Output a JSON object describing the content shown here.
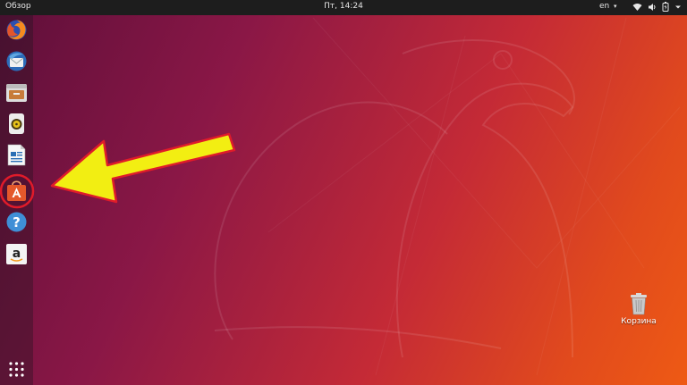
{
  "topbar": {
    "activities_label": "Обзор",
    "clock": "Пт, 14:24",
    "language": "en",
    "language_arrow": "▾",
    "wifi_icon": "wifi-icon",
    "volume_icon": "volume-icon",
    "battery_icon": "battery-icon",
    "menu_icon": "system-menu-arrow-icon"
  },
  "dock": {
    "items": [
      {
        "name": "firefox",
        "icon": "firefox-icon"
      },
      {
        "name": "thunderbird",
        "icon": "thunderbird-icon"
      },
      {
        "name": "files",
        "icon": "files-icon"
      },
      {
        "name": "rhythmbox",
        "icon": "rhythmbox-icon"
      },
      {
        "name": "libreoffice-writer",
        "icon": "writer-icon"
      },
      {
        "name": "ubuntu-software",
        "icon": "software-center-icon",
        "highlighted": true
      },
      {
        "name": "help",
        "icon": "help-icon"
      },
      {
        "name": "amazon",
        "icon": "amazon-icon"
      }
    ],
    "show_apps_icon": "grid-icon"
  },
  "desktop": {
    "trash_label": "Корзина",
    "trash_icon": "trash-icon"
  },
  "colors": {
    "topbar": "#1d1d1d",
    "arrow_fill": "#f2ee12",
    "arrow_outline": "#e01b2a",
    "highlight_circle": "#e01b2a"
  }
}
